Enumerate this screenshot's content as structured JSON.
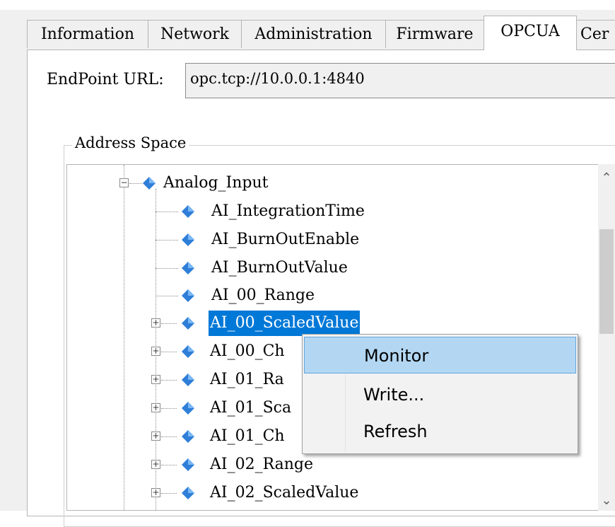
{
  "tabs": [
    "Information",
    "Network",
    "Administration",
    "Firmware",
    "OPCUA",
    "Cer"
  ],
  "active_tab": "OPCUA",
  "endpoint": {
    "label": "EndPoint URL:",
    "value": "opc.tcp://10.0.0.1:4840"
  },
  "address_space": {
    "title": "Address Space",
    "parent": "Analog_Input",
    "children": [
      "AI_IntegrationTime",
      "AI_BurnOutEnable",
      "AI_BurnOutValue",
      "AI_00_Range",
      "AI_00_ScaledValue",
      "AI_00_Ch",
      "AI_01_Ra",
      "AI_01_Sca",
      "AI_01_Ch",
      "AI_02_Range",
      "AI_02_ScaledValue"
    ],
    "selected": "AI_00_ScaledValue"
  },
  "context_menu": {
    "items": [
      "Monitor",
      "Write...",
      "Refresh"
    ],
    "highlighted": "Monitor"
  },
  "colors": {
    "selection": "#0078d7",
    "menu_hover": "#b3d7f3",
    "gem": "#2f7ed8"
  }
}
